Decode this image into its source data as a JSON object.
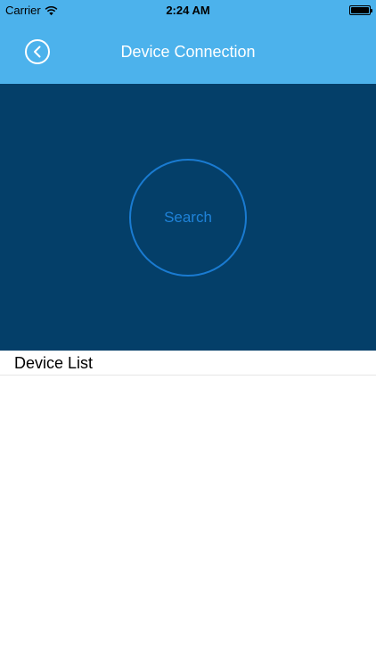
{
  "status_bar": {
    "carrier": "Carrier",
    "time": "2:24 AM",
    "icons": [
      "wifi-icon",
      "battery-icon"
    ]
  },
  "nav": {
    "title": "Device Connection",
    "back_icon": "chevron-left-icon"
  },
  "search": {
    "label": "Search"
  },
  "device_list": {
    "header": "Device List",
    "items": []
  },
  "colors": {
    "nav_background": "#4cb2ec",
    "panel_background": "#043f69",
    "search_ring": "#1a7bd1",
    "search_text": "#1f82d8",
    "list_background": "#ffffff"
  }
}
